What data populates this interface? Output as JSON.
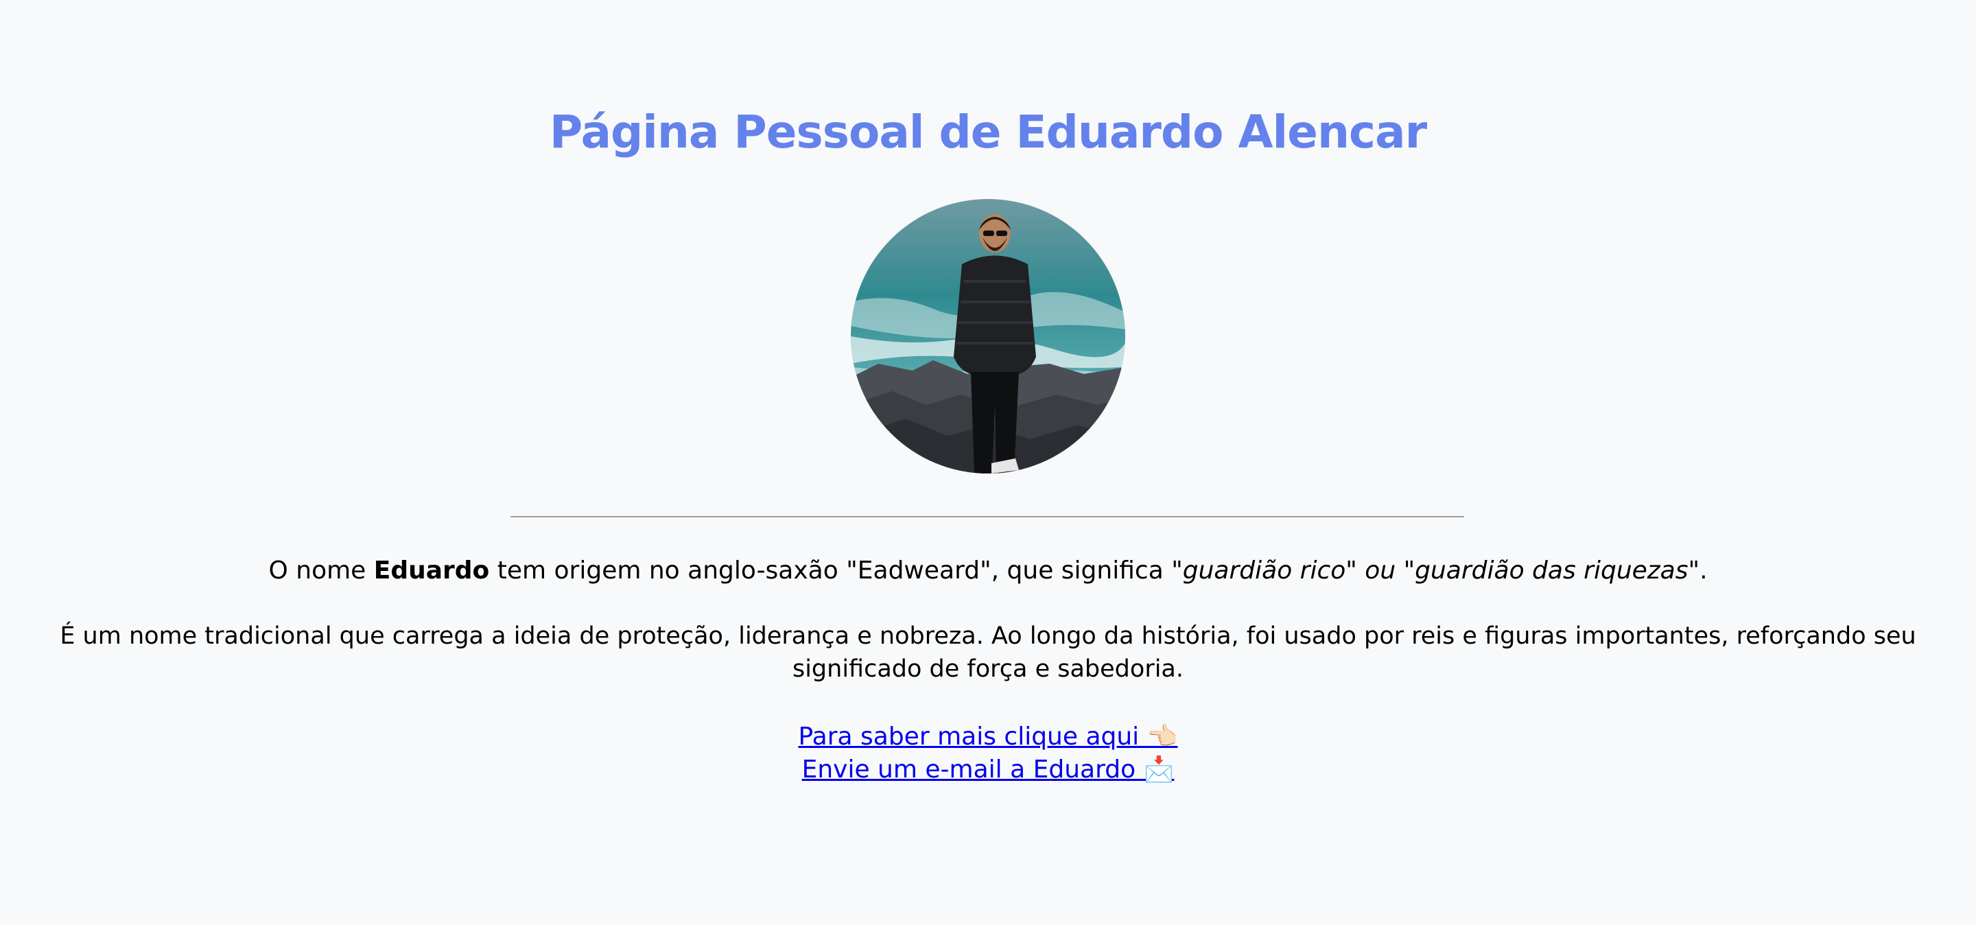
{
  "page": {
    "title": "Página Pessoal de Eduardo Alencar"
  },
  "intro": {
    "prefix": "O nome ",
    "name": "Eduardo",
    "middle": " tem origem no anglo-saxão \"Eadweard\", que significa ",
    "meaning": "\"guardião rico\" ou \"guardião das riquezas\"",
    "suffix": "."
  },
  "description": "É um nome tradicional que carrega a ideia de proteção, liderança e nobreza. Ao longo da história, foi usado por reis e figuras importantes, reforçando seu significado de força e sabedoria.",
  "links": {
    "learn_more": "Para saber mais clique aqui 👈🏻",
    "email": "Envie um e-mail a Eduardo 📩"
  },
  "colors": {
    "title": "#6482eb",
    "link": "#0000ee",
    "background": "#f8f9fa"
  }
}
